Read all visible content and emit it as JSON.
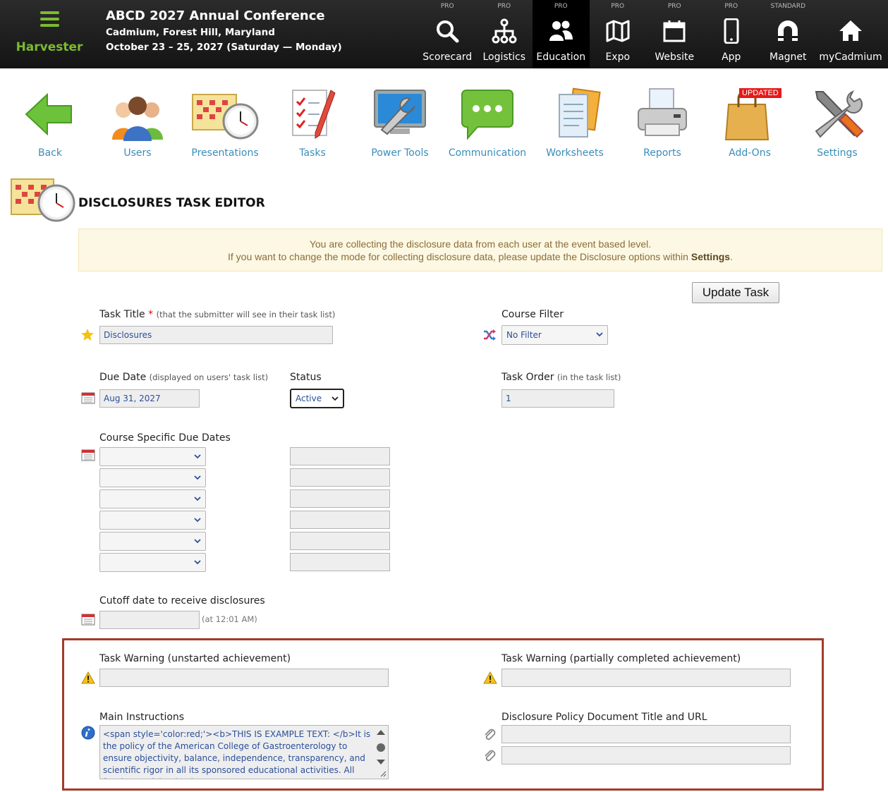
{
  "app": {
    "brand": "Harvester",
    "event_title": "ABCD 2027 Annual Conference",
    "event_location": "Cadmium, Forest Hill, Maryland",
    "event_dates": "October 23 – 25, 2027 (Saturday — Monday)"
  },
  "topnav": [
    {
      "tier": "PRO",
      "label": "Scorecard",
      "icon": "search-icon"
    },
    {
      "tier": "PRO",
      "label": "Logistics",
      "icon": "org-chart-icon"
    },
    {
      "tier": "PRO",
      "label": "Education",
      "icon": "users-icon",
      "active": true
    },
    {
      "tier": "PRO",
      "label": "Expo",
      "icon": "map-icon"
    },
    {
      "tier": "PRO",
      "label": "Website",
      "icon": "calendar-icon"
    },
    {
      "tier": "PRO",
      "label": "App",
      "icon": "phone-icon"
    },
    {
      "tier": "STANDARD",
      "label": "Magnet",
      "icon": "magnet-icon"
    },
    {
      "tier": "",
      "label": "myCadmium",
      "icon": "home-icon"
    }
  ],
  "tools": [
    {
      "label": "Back",
      "icon": "back-arrow-icon"
    },
    {
      "label": "Users",
      "icon": "users-group-icon"
    },
    {
      "label": "Presentations",
      "icon": "calendar-clock-icon"
    },
    {
      "label": "Tasks",
      "icon": "checklist-icon"
    },
    {
      "label": "Power Tools",
      "icon": "monitor-wrench-icon"
    },
    {
      "label": "Communication",
      "icon": "chat-bubble-icon"
    },
    {
      "label": "Worksheets",
      "icon": "documents-icon"
    },
    {
      "label": "Reports",
      "icon": "printer-icon"
    },
    {
      "label": "Add-Ons",
      "icon": "shopping-bag-icon",
      "badge": "UPDATED"
    },
    {
      "label": "Settings",
      "icon": "tools-icon"
    }
  ],
  "page": {
    "title": "DISCLOSURES TASK EDITOR",
    "notice_line1": "You are collecting the disclosure data from each user at the event based level.",
    "notice_line2_pre": "If you want to change the mode for collecting disclosure data, please update the Disclosure options within ",
    "notice_line2_link": "Settings",
    "notice_line2_post": ".",
    "update_button": "Update Task"
  },
  "form": {
    "task_title_label": "Task Title",
    "task_title_required": "*",
    "task_title_hint": "(that the submitter will see in their task list)",
    "task_title_value": "Disclosures",
    "course_filter_label": "Course Filter",
    "course_filter_value": "No Filter",
    "due_date_label": "Due Date",
    "due_date_hint": "(displayed on users' task list)",
    "due_date_value": "Aug 31, 2027",
    "status_label": "Status",
    "status_value": "Active",
    "task_order_label": "Task Order",
    "task_order_hint": "(in the task list)",
    "task_order_value": "1",
    "course_due_label": "Course Specific Due Dates",
    "cutoff_label": "Cutoff date to receive disclosures",
    "cutoff_value": "",
    "cutoff_hint": "(at 12:01 AM)",
    "warning_unstarted_label": "Task Warning (unstarted achievement)",
    "warning_unstarted_value": "",
    "warning_partial_label": "Task Warning (partially completed achievement)",
    "warning_partial_value": "",
    "instructions_label": "Main Instructions",
    "instructions_value": "<span style='color:red;'><b>THIS IS EXAMPLE TEXT: </b>It is the policy of the American College of Gastroenterology to ensure objectivity, balance, independence, transparency, and scientific rigor in all its sponsored educational activities. All faculty participating in",
    "policy_doc_label": "Disclosure Policy Document Title and URL",
    "policy_doc_title": "",
    "policy_doc_url": ""
  },
  "colors": {
    "brand_green": "#7cbb2f",
    "link_blue": "#3a8db8",
    "frame_red": "#a33a2a",
    "notice_bg": "#fcf8e3"
  }
}
